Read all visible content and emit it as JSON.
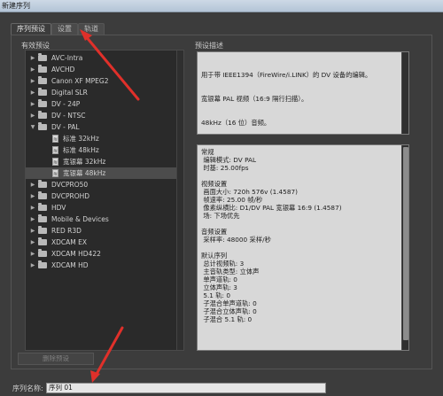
{
  "window": {
    "title": "新建序列"
  },
  "tabs": [
    {
      "label": "序列预设",
      "active": true
    },
    {
      "label": "设置",
      "active": false
    },
    {
      "label": "轨道",
      "active": false
    }
  ],
  "presets": {
    "label": "有效预设",
    "items": [
      {
        "label": "AVC-Intra",
        "type": "folder",
        "expanded": false
      },
      {
        "label": "AVCHD",
        "type": "folder",
        "expanded": false
      },
      {
        "label": "Canon XF MPEG2",
        "type": "folder",
        "expanded": false
      },
      {
        "label": "Digital SLR",
        "type": "folder",
        "expanded": false
      },
      {
        "label": "DV - 24P",
        "type": "folder",
        "expanded": false
      },
      {
        "label": "DV - NTSC",
        "type": "folder",
        "expanded": false
      },
      {
        "label": "DV - PAL",
        "type": "folder",
        "expanded": true
      },
      {
        "label": "标准 32kHz",
        "type": "file"
      },
      {
        "label": "标准 48kHz",
        "type": "file"
      },
      {
        "label": "宽银幕 32kHz",
        "type": "file"
      },
      {
        "label": "宽银幕 48kHz",
        "type": "file",
        "selected": true
      },
      {
        "label": "DVCPRO50",
        "type": "folder",
        "expanded": false
      },
      {
        "label": "DVCPROHD",
        "type": "folder",
        "expanded": false
      },
      {
        "label": "HDV",
        "type": "folder",
        "expanded": false
      },
      {
        "label": "Mobile & Devices",
        "type": "folder",
        "expanded": false
      },
      {
        "label": "RED R3D",
        "type": "folder",
        "expanded": false
      },
      {
        "label": "XDCAM EX",
        "type": "folder",
        "expanded": false
      },
      {
        "label": "XDCAM HD422",
        "type": "folder",
        "expanded": false
      },
      {
        "label": "XDCAM HD",
        "type": "folder",
        "expanded": false
      }
    ],
    "delete_label": "删除预设"
  },
  "description": {
    "label": "预设描述",
    "lines": [
      "用于带 IEEE1394（FireWire/i.LINK）的 DV 设备的编辑。",
      "宽银幕 PAL 视频（16:9 隔行扫描）。",
      "48kHz（16 位）音频。"
    ]
  },
  "details": {
    "lines": [
      "常规",
      " 编辑模式: DV PAL",
      " 时基: 25.00fps",
      "",
      "视频设置",
      " 画面大小: 720h 576v (1.4587)",
      " 帧速率: 25.00 帧/秒",
      " 像素纵横比: D1/DV PAL 宽银幕 16:9 (1.4587)",
      " 场: 下场优先",
      "",
      "音频设置",
      " 采样率: 48000 采样/秒",
      "",
      "默认序列",
      " 总计视频轨: 3",
      " 主音轨类型: 立体声",
      " 单声道轨: 0",
      " 立体声轨: 3",
      " 5.1 轨: 0",
      " 子混合单声道轨: 0",
      " 子混合立体声轨: 0",
      " 子混合 5.1 轨: 0"
    ]
  },
  "sequence_name": {
    "label": "序列名称:",
    "value": "序列 01"
  },
  "colors": {
    "annotation_arrow": "#e0302a"
  }
}
